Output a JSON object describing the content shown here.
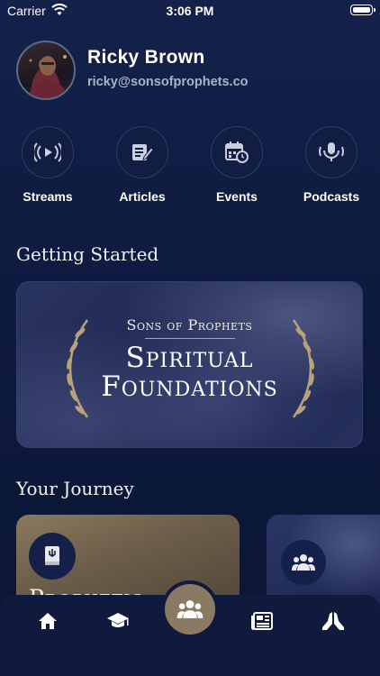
{
  "status_bar": {
    "carrier": "Carrier",
    "time": "3:06 PM"
  },
  "profile": {
    "name": "Ricky Brown",
    "email": "ricky@sonsofprophets.co"
  },
  "quick_links": [
    {
      "label": "Streams",
      "icon": "streams-icon"
    },
    {
      "label": "Articles",
      "icon": "articles-icon"
    },
    {
      "label": "Events",
      "icon": "events-icon"
    },
    {
      "label": "Podcasts",
      "icon": "podcasts-icon"
    }
  ],
  "getting_started": {
    "title": "Getting Started",
    "banner": {
      "subtitle": "Sons of Prophets",
      "line1": "Spiritual",
      "line2": "Foundations"
    }
  },
  "journey": {
    "title": "Your Journey",
    "cards": [
      {
        "label": "Prophetic",
        "icon": "book-icon"
      },
      {
        "label": "",
        "icon": "group-icon"
      }
    ]
  },
  "tab_bar": {
    "items": [
      "home-icon",
      "graduation-cap-icon",
      "community-icon",
      "newspaper-icon",
      "praying-hands-icon"
    ],
    "active": "community-icon"
  },
  "colors": {
    "background": "#0e1a3e",
    "accent": "#8a7a63",
    "gold": "#b9a27a"
  }
}
